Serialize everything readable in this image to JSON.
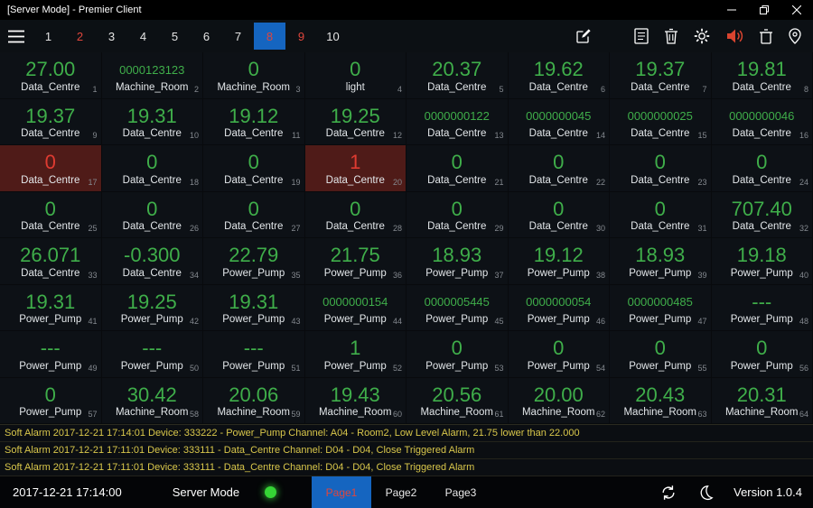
{
  "titlebar": {
    "title": "[Server Mode] - Premier Client"
  },
  "toolbar": {
    "tabs": [
      {
        "label": "1",
        "state": "normal"
      },
      {
        "label": "2",
        "state": "alert"
      },
      {
        "label": "3",
        "state": "normal"
      },
      {
        "label": "4",
        "state": "normal"
      },
      {
        "label": "5",
        "state": "normal"
      },
      {
        "label": "6",
        "state": "normal"
      },
      {
        "label": "7",
        "state": "normal"
      },
      {
        "label": "8",
        "state": "selected-alert"
      },
      {
        "label": "9",
        "state": "alert"
      },
      {
        "label": "10",
        "state": "normal"
      }
    ],
    "icons": [
      "menu-icon",
      "edit-icon",
      "note-icon",
      "trash-icon",
      "settings-icon",
      "speaker-icon",
      "bin-icon",
      "location-icon"
    ]
  },
  "grid": {
    "tiles": [
      {
        "value": "27.00",
        "label": "Data_Centre",
        "index": "1",
        "state": "normal",
        "long": false
      },
      {
        "value": "0000123123",
        "label": "Machine_Room",
        "index": "2",
        "state": "normal",
        "long": true
      },
      {
        "value": "0",
        "label": "Machine_Room",
        "index": "3",
        "state": "normal",
        "long": false
      },
      {
        "value": "0",
        "label": "light",
        "index": "4",
        "state": "normal",
        "long": false
      },
      {
        "value": "20.37",
        "label": "Data_Centre",
        "index": "5",
        "state": "normal",
        "long": false
      },
      {
        "value": "19.62",
        "label": "Data_Centre",
        "index": "6",
        "state": "normal",
        "long": false
      },
      {
        "value": "19.37",
        "label": "Data_Centre",
        "index": "7",
        "state": "normal",
        "long": false
      },
      {
        "value": "19.81",
        "label": "Data_Centre",
        "index": "8",
        "state": "normal",
        "long": false
      },
      {
        "value": "19.37",
        "label": "Data_Centre",
        "index": "9",
        "state": "normal",
        "long": false
      },
      {
        "value": "19.31",
        "label": "Data_Centre",
        "index": "10",
        "state": "normal",
        "long": false
      },
      {
        "value": "19.12",
        "label": "Data_Centre",
        "index": "11",
        "state": "normal",
        "long": false
      },
      {
        "value": "19.25",
        "label": "Data_Centre",
        "index": "12",
        "state": "normal",
        "long": false
      },
      {
        "value": "0000000122",
        "label": "Data_Centre",
        "index": "13",
        "state": "normal",
        "long": true
      },
      {
        "value": "0000000045",
        "label": "Data_Centre",
        "index": "14",
        "state": "normal",
        "long": true
      },
      {
        "value": "0000000025",
        "label": "Data_Centre",
        "index": "15",
        "state": "normal",
        "long": true
      },
      {
        "value": "0000000046",
        "label": "Data_Centre",
        "index": "16",
        "state": "normal",
        "long": true
      },
      {
        "value": "0",
        "label": "Data_Centre",
        "index": "17",
        "state": "alarm",
        "long": false
      },
      {
        "value": "0",
        "label": "Data_Centre",
        "index": "18",
        "state": "normal",
        "long": false
      },
      {
        "value": "0",
        "label": "Data_Centre",
        "index": "19",
        "state": "normal",
        "long": false
      },
      {
        "value": "1",
        "label": "Data_Centre",
        "index": "20",
        "state": "alarm",
        "long": false
      },
      {
        "value": "0",
        "label": "Data_Centre",
        "index": "21",
        "state": "normal",
        "long": false
      },
      {
        "value": "0",
        "label": "Data_Centre",
        "index": "22",
        "state": "normal",
        "long": false
      },
      {
        "value": "0",
        "label": "Data_Centre",
        "index": "23",
        "state": "normal",
        "long": false
      },
      {
        "value": "0",
        "label": "Data_Centre",
        "index": "24",
        "state": "normal",
        "long": false
      },
      {
        "value": "0",
        "label": "Data_Centre",
        "index": "25",
        "state": "normal",
        "long": false
      },
      {
        "value": "0",
        "label": "Data_Centre",
        "index": "26",
        "state": "normal",
        "long": false
      },
      {
        "value": "0",
        "label": "Data_Centre",
        "index": "27",
        "state": "normal",
        "long": false
      },
      {
        "value": "0",
        "label": "Data_Centre",
        "index": "28",
        "state": "normal",
        "long": false
      },
      {
        "value": "0",
        "label": "Data_Centre",
        "index": "29",
        "state": "normal",
        "long": false
      },
      {
        "value": "0",
        "label": "Data_Centre",
        "index": "30",
        "state": "normal",
        "long": false
      },
      {
        "value": "0",
        "label": "Data_Centre",
        "index": "31",
        "state": "normal",
        "long": false
      },
      {
        "value": "707.40",
        "label": "Data_Centre",
        "index": "32",
        "state": "normal",
        "long": false
      },
      {
        "value": "26.071",
        "label": "Data_Centre",
        "index": "33",
        "state": "normal",
        "long": false
      },
      {
        "value": "-0.300",
        "label": "Data_Centre",
        "index": "34",
        "state": "normal",
        "long": false
      },
      {
        "value": "22.79",
        "label": "Power_Pump",
        "index": "35",
        "state": "normal",
        "long": false
      },
      {
        "value": "21.75",
        "label": "Power_Pump",
        "index": "36",
        "state": "normal",
        "long": false
      },
      {
        "value": "18.93",
        "label": "Power_Pump",
        "index": "37",
        "state": "normal",
        "long": false
      },
      {
        "value": "19.12",
        "label": "Power_Pump",
        "index": "38",
        "state": "normal",
        "long": false
      },
      {
        "value": "18.93",
        "label": "Power_Pump",
        "index": "39",
        "state": "normal",
        "long": false
      },
      {
        "value": "19.18",
        "label": "Power_Pump",
        "index": "40",
        "state": "normal",
        "long": false
      },
      {
        "value": "19.31",
        "label": "Power_Pump",
        "index": "41",
        "state": "normal",
        "long": false
      },
      {
        "value": "19.25",
        "label": "Power_Pump",
        "index": "42",
        "state": "normal",
        "long": false
      },
      {
        "value": "19.31",
        "label": "Power_Pump",
        "index": "43",
        "state": "normal",
        "long": false
      },
      {
        "value": "0000000154",
        "label": "Power_Pump",
        "index": "44",
        "state": "normal",
        "long": true
      },
      {
        "value": "0000005445",
        "label": "Power_Pump",
        "index": "45",
        "state": "normal",
        "long": true
      },
      {
        "value": "0000000054",
        "label": "Power_Pump",
        "index": "46",
        "state": "normal",
        "long": true
      },
      {
        "value": "0000000485",
        "label": "Power_Pump",
        "index": "47",
        "state": "normal",
        "long": true
      },
      {
        "value": "---",
        "label": "Power_Pump",
        "index": "48",
        "state": "normal",
        "long": false
      },
      {
        "value": "---",
        "label": "Power_Pump",
        "index": "49",
        "state": "normal",
        "long": false
      },
      {
        "value": "---",
        "label": "Power_Pump",
        "index": "50",
        "state": "normal",
        "long": false
      },
      {
        "value": "---",
        "label": "Power_Pump",
        "index": "51",
        "state": "normal",
        "long": false
      },
      {
        "value": "1",
        "label": "Power_Pump",
        "index": "52",
        "state": "normal",
        "long": false
      },
      {
        "value": "0",
        "label": "Power_Pump",
        "index": "53",
        "state": "normal",
        "long": false
      },
      {
        "value": "0",
        "label": "Power_Pump",
        "index": "54",
        "state": "normal",
        "long": false
      },
      {
        "value": "0",
        "label": "Power_Pump",
        "index": "55",
        "state": "normal",
        "long": false
      },
      {
        "value": "0",
        "label": "Power_Pump",
        "index": "56",
        "state": "normal",
        "long": false
      },
      {
        "value": "0",
        "label": "Power_Pump",
        "index": "57",
        "state": "normal",
        "long": false
      },
      {
        "value": "30.42",
        "label": "Machine_Room",
        "index": "58",
        "state": "normal",
        "long": false
      },
      {
        "value": "20.06",
        "label": "Machine_Room",
        "index": "59",
        "state": "normal",
        "long": false
      },
      {
        "value": "19.43",
        "label": "Machine_Room",
        "index": "60",
        "state": "normal",
        "long": false
      },
      {
        "value": "20.56",
        "label": "Machine_Room",
        "index": "61",
        "state": "normal",
        "long": false
      },
      {
        "value": "20.00",
        "label": "Machine_Room",
        "index": "62",
        "state": "normal",
        "long": false
      },
      {
        "value": "20.43",
        "label": "Machine_Room",
        "index": "63",
        "state": "normal",
        "long": false
      },
      {
        "value": "20.31",
        "label": "Machine_Room",
        "index": "64",
        "state": "normal",
        "long": false
      }
    ]
  },
  "alarms": [
    "Soft Alarm 2017-12-21 17:14:01 Device: 333222 - Power_Pump Channel: A04 - Room2, Low Level Alarm, 21.75 lower than 22.000",
    "Soft Alarm 2017-12-21 17:11:01 Device: 333111 - Data_Centre Channel: D04 - D04, Close Triggered Alarm",
    "Soft Alarm 2017-12-21 17:11:01 Device: 333111 - Data_Centre Channel: D04 - D04, Close Triggered Alarm"
  ],
  "statusbar": {
    "datetime": "2017-12-21 17:14:00",
    "mode": "Server Mode",
    "pages": [
      {
        "label": "Page1",
        "active": true
      },
      {
        "label": "Page2",
        "active": false
      },
      {
        "label": "Page3",
        "active": false
      }
    ],
    "icons": [
      "sync-icon",
      "moon-icon"
    ],
    "version": "Version 1.0.4"
  },
  "colors": {
    "value_green": "#3fae4a",
    "value_red": "#de3b31",
    "alarm_tile_bg": "#4f1b18",
    "accent_blue": "#1565c0",
    "alarm_text_yellow": "#d9c74b",
    "status_indicator_green": "#35d435",
    "speaker_red": "#d9442f"
  }
}
